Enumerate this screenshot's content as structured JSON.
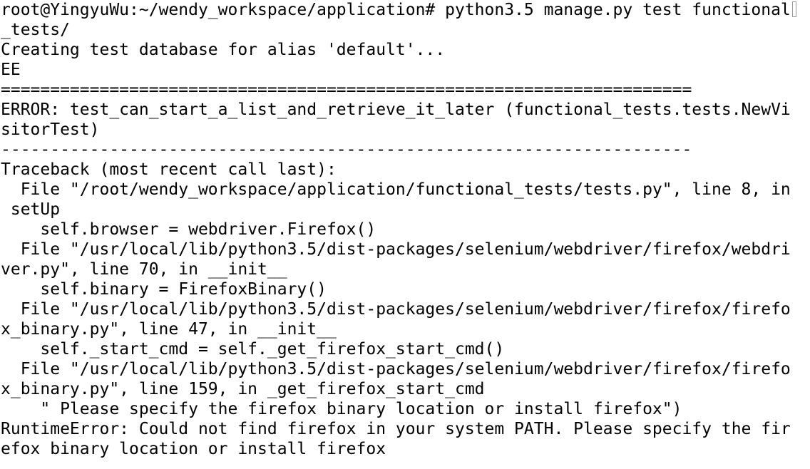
{
  "terminal": {
    "lines": [
      "root@YingyuWu:~/wendy_workspace/application# python3.5 manage.py test functional",
      "_tests/",
      "Creating test database for alias 'default'...",
      "EE",
      "======================================================================",
      "ERROR: test_can_start_a_list_and_retrieve_it_later (functional_tests.tests.NewVi",
      "sitorTest)",
      "----------------------------------------------------------------------",
      "Traceback (most recent call last):",
      "  File \"/root/wendy_workspace/application/functional_tests/tests.py\", line 8, in",
      " setUp",
      "    self.browser = webdriver.Firefox()",
      "  File \"/usr/local/lib/python3.5/dist-packages/selenium/webdriver/firefox/webdri",
      "ver.py\", line 70, in __init__",
      "    self.binary = FirefoxBinary()",
      "  File \"/usr/local/lib/python3.5/dist-packages/selenium/webdriver/firefox/firefo",
      "x_binary.py\", line 47, in __init__",
      "    self._start_cmd = self._get_firefox_start_cmd()",
      "  File \"/usr/local/lib/python3.5/dist-packages/selenium/webdriver/firefox/firefo",
      "x_binary.py\", line 159, in _get_firefox_start_cmd",
      "    \" Please specify the firefox binary location or install firefox\")",
      "RuntimeError: Could not find firefox in your system PATH. Please specify the fir",
      "efox binary location or install firefox"
    ]
  }
}
